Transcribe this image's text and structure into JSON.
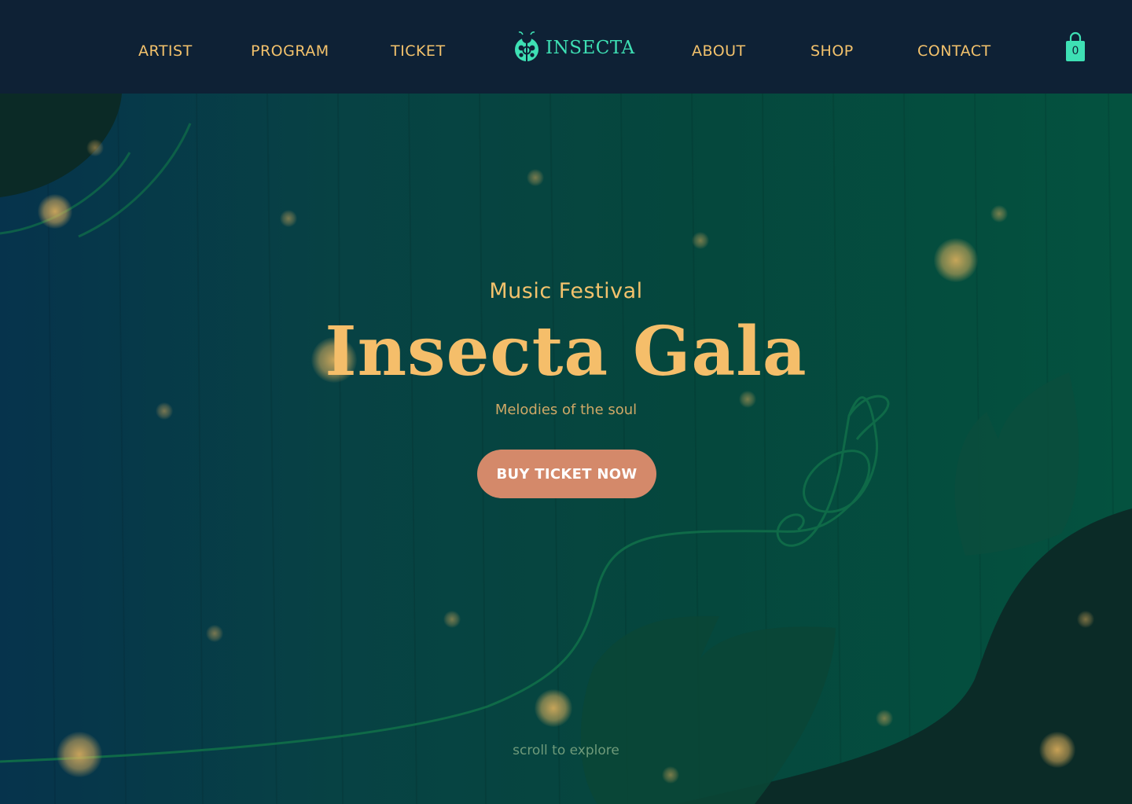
{
  "nav": {
    "left": [
      "ARTIST",
      "PROGRAM",
      "TICKET"
    ],
    "right": [
      "ABOUT",
      "SHOP",
      "CONTACT"
    ]
  },
  "logo": {
    "text": "INSECTA",
    "icon": "ladybug-icon"
  },
  "cart": {
    "count": "0",
    "icon": "shopping-bag-icon"
  },
  "hero": {
    "subtitle": "Music Festival",
    "title": "Insecta Gala",
    "tagline": "Melodies of the soul",
    "cta_label": "BUY TICKET NOW",
    "scroll_hint": "scroll to explore"
  },
  "colors": {
    "header_bg": "#0e2135",
    "nav_text": "#f3c26c",
    "logo_accent": "#3ee0b4",
    "title": "#f5be6a",
    "cta_bg": "#d4896a",
    "hero_left": "#06334c",
    "hero_right": "#04523f"
  }
}
